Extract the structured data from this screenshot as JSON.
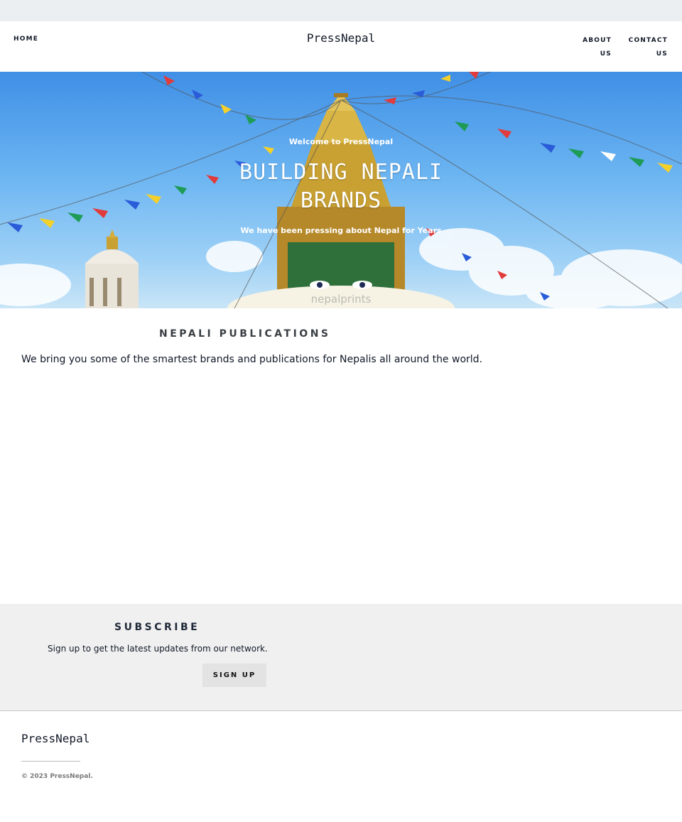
{
  "header": {
    "brand": "PressNepal",
    "nav_home": "HOME",
    "nav_about": "ABOUT\nUS",
    "nav_contact": "CONTACT\nUS"
  },
  "hero": {
    "eyebrow": "Welcome to PressNepal",
    "title": "BUILDING NEPALI\nBRANDS",
    "subtitle": "We have been pressing about Nepal for Years",
    "watermark": "nepalprints",
    "colors": {
      "sky": "#5aa8ee",
      "stupa_gold": "#c9a032"
    }
  },
  "publications": {
    "heading": "NEPALI PUBLICATIONS",
    "text": "We bring you some of the smartest brands and publications for Nepalis all around the world."
  },
  "subscribe": {
    "heading": "SUBSCRIBE",
    "text": "Sign up to get the latest updates from our network.",
    "button": "SIGN UP"
  },
  "footer": {
    "brand": "PressNepal",
    "copyright": "© 2023 PressNepal."
  }
}
